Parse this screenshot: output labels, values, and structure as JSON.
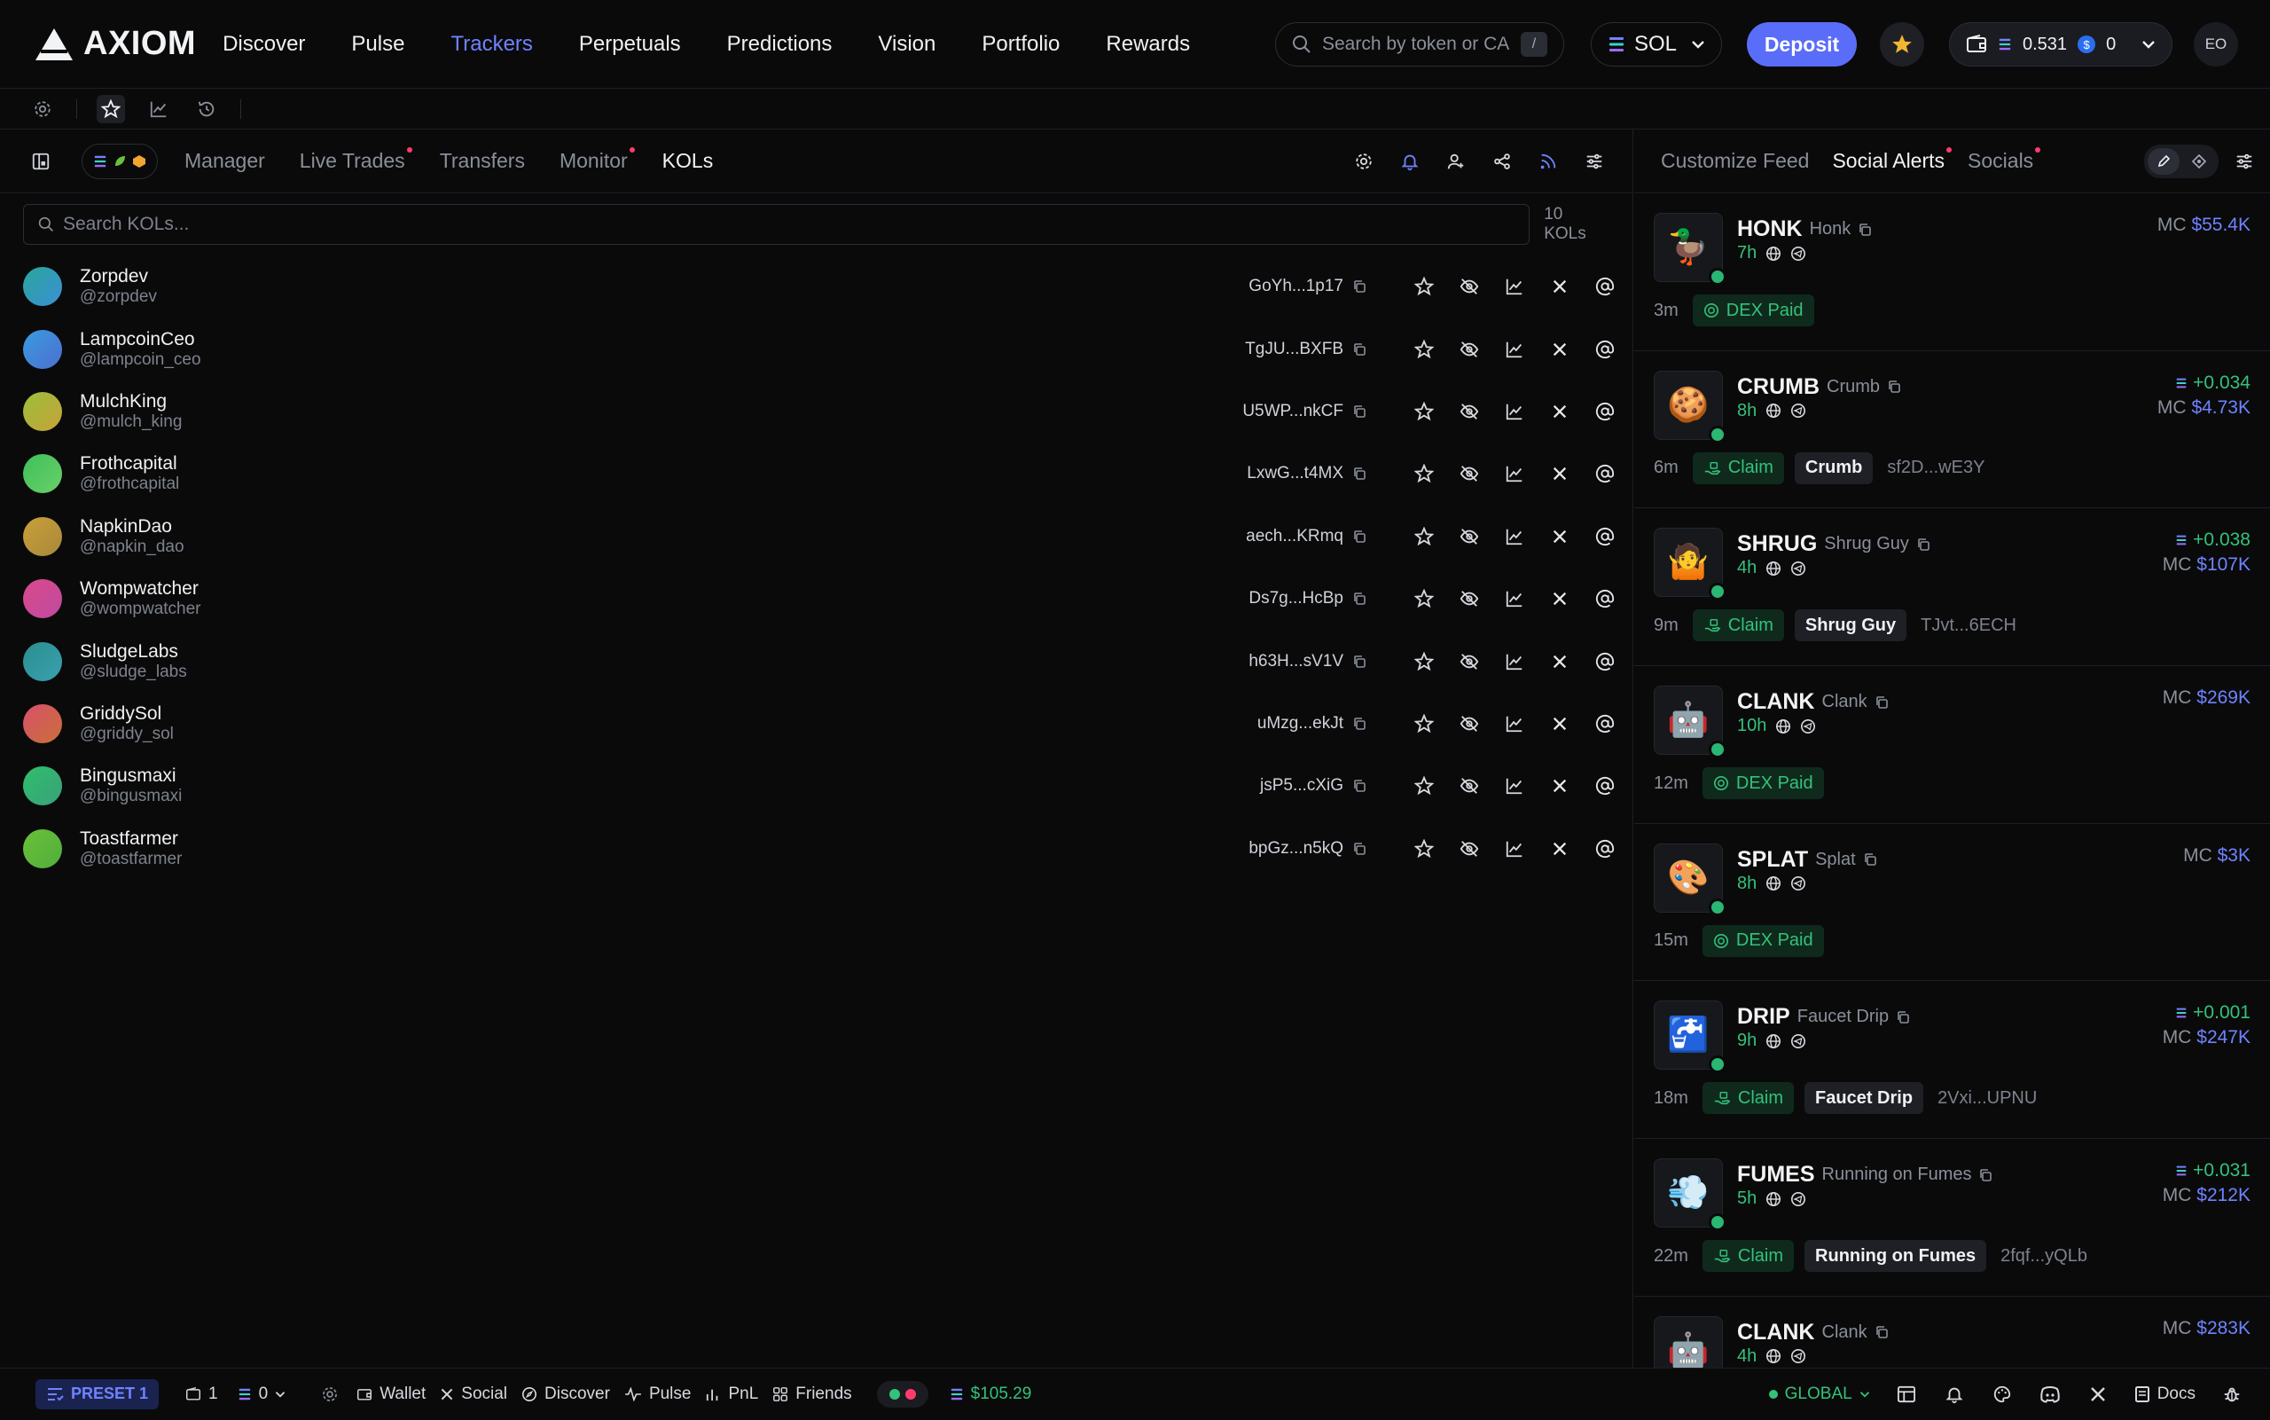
{
  "brand": {
    "name": "AXIOM"
  },
  "nav": {
    "items": [
      {
        "label": "Discover",
        "active": false
      },
      {
        "label": "Pulse",
        "active": false
      },
      {
        "label": "Trackers",
        "active": true
      },
      {
        "label": "Perpetuals",
        "active": false
      },
      {
        "label": "Predictions",
        "active": false
      },
      {
        "label": "Vision",
        "active": false
      },
      {
        "label": "Portfolio",
        "active": false
      },
      {
        "label": "Rewards",
        "active": false
      }
    ],
    "search_placeholder": "Search by token or CA",
    "search_shortcut": "/",
    "chain": "SOL",
    "deposit_label": "Deposit",
    "wallet_sol": "0.531",
    "wallet_usdc": "0",
    "user_initials": "EO"
  },
  "left": {
    "tabs": [
      {
        "label": "Manager",
        "dot": false,
        "active": false
      },
      {
        "label": "Live Trades",
        "dot": true,
        "active": false
      },
      {
        "label": "Transfers",
        "dot": false,
        "active": false
      },
      {
        "label": "Monitor",
        "dot": true,
        "active": false
      },
      {
        "label": "KOLs",
        "dot": false,
        "active": true
      }
    ],
    "search_placeholder": "Search KOLs...",
    "count_label": "10 KOLs",
    "kols": [
      {
        "name": "Zorpdev",
        "handle": "@zorpdev",
        "addr": "GoYh...1p17",
        "c1": "#2aa69a",
        "c2": "#3b8fd6"
      },
      {
        "name": "LampcoinCeo",
        "handle": "@lampcoin_ceo",
        "addr": "TgJU...BXFB",
        "c1": "#3a9be0",
        "c2": "#4d6fd0"
      },
      {
        "name": "MulchKing",
        "handle": "@mulch_king",
        "addr": "U5WP...nkCF",
        "c1": "#9bbf3a",
        "c2": "#c7a23a"
      },
      {
        "name": "Frothcapital",
        "handle": "@frothcapital",
        "addr": "LxwG...t4MX",
        "c1": "#3fbf5a",
        "c2": "#6ad06a"
      },
      {
        "name": "NapkinDao",
        "handle": "@napkin_dao",
        "addr": "aech...KRmq",
        "c1": "#c9a03a",
        "c2": "#a8883a"
      },
      {
        "name": "Wompwatcher",
        "handle": "@wompwatcher",
        "addr": "Ds7g...HcBp",
        "c1": "#d94a8a",
        "c2": "#c04aa0"
      },
      {
        "name": "SludgeLabs",
        "handle": "@sludge_labs",
        "addr": "h63H...sV1V",
        "c1": "#2a8f8f",
        "c2": "#3aa0b0"
      },
      {
        "name": "GriddySol",
        "handle": "@griddy_sol",
        "addr": "uMzg...ekJt",
        "c1": "#d9506a",
        "c2": "#c8703a"
      },
      {
        "name": "Bingusmaxi",
        "handle": "@bingusmaxi",
        "addr": "jsP5...cXiG",
        "c1": "#2fbf6a",
        "c2": "#3aa07a"
      },
      {
        "name": "Toastfarmer",
        "handle": "@toastfarmer",
        "addr": "bpGz...n5kQ",
        "c1": "#6cc03a",
        "c2": "#4fae3a"
      }
    ]
  },
  "right": {
    "tabs": [
      {
        "label": "Customize Feed",
        "dot": false,
        "active": false
      },
      {
        "label": "Social Alerts",
        "dot": true,
        "active": true
      },
      {
        "label": "Socials",
        "dot": true,
        "active": false
      }
    ],
    "alerts": [
      {
        "symbol": "HONK",
        "name": "Honk",
        "age": "7h",
        "emoji": "🦆",
        "gain": "",
        "mc": "$55.4K",
        "time": "3m",
        "tag": "DEX Paid",
        "tag_kind": "dex",
        "label": "",
        "addr": ""
      },
      {
        "symbol": "CRUMB",
        "name": "Crumb",
        "age": "8h",
        "emoji": "🍪",
        "gain": "+0.034",
        "mc": "$4.73K",
        "time": "6m",
        "tag": "Claim",
        "tag_kind": "claim",
        "label": "Crumb",
        "addr": "sf2D...wE3Y"
      },
      {
        "symbol": "SHRUG",
        "name": "Shrug Guy",
        "age": "4h",
        "emoji": "🤷",
        "gain": "+0.038",
        "mc": "$107K",
        "time": "9m",
        "tag": "Claim",
        "tag_kind": "claim",
        "label": "Shrug Guy",
        "addr": "TJvt...6ECH"
      },
      {
        "symbol": "CLANK",
        "name": "Clank",
        "age": "10h",
        "emoji": "🤖",
        "gain": "",
        "mc": "$269K",
        "time": "12m",
        "tag": "DEX Paid",
        "tag_kind": "dex",
        "label": "",
        "addr": ""
      },
      {
        "symbol": "SPLAT",
        "name": "Splat",
        "age": "8h",
        "emoji": "🎨",
        "gain": "",
        "mc": "$3K",
        "time": "15m",
        "tag": "DEX Paid",
        "tag_kind": "dex",
        "label": "",
        "addr": ""
      },
      {
        "symbol": "DRIP",
        "name": "Faucet Drip",
        "age": "9h",
        "emoji": "🚰",
        "gain": "+0.001",
        "mc": "$247K",
        "time": "18m",
        "tag": "Claim",
        "tag_kind": "claim",
        "label": "Faucet Drip",
        "addr": "2Vxi...UPNU"
      },
      {
        "symbol": "FUMES",
        "name": "Running on Fumes",
        "age": "5h",
        "emoji": "💨",
        "gain": "+0.031",
        "mc": "$212K",
        "time": "22m",
        "tag": "Claim",
        "tag_kind": "claim",
        "label": "Running on Fumes",
        "addr": "2fqf...yQLb"
      },
      {
        "symbol": "CLANK",
        "name": "Clank",
        "age": "4h",
        "emoji": "🤖",
        "gain": "",
        "mc": "$283K",
        "time": "",
        "tag": "",
        "tag_kind": "",
        "label": "",
        "addr": ""
      }
    ],
    "mc_prefix": "MC"
  },
  "bottom": {
    "preset": "PRESET 1",
    "wallet_count": "1",
    "sol_count": "0",
    "links": [
      "Wallet",
      "Social",
      "Discover",
      "Pulse",
      "PnL",
      "Friends"
    ],
    "sol_price": "$105.29",
    "region": "GLOBAL",
    "docs": "Docs"
  },
  "colors": {
    "accent": "#5a6df8",
    "active_nav": "#6f83ff",
    "green": "#34c27a",
    "red_dot": "#ff3b6b"
  }
}
